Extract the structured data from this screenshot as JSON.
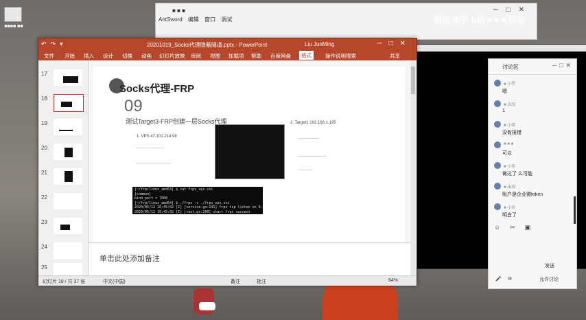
{
  "desktop": {
    "icon_label": "■■■■\n■■"
  },
  "antsword": {
    "title": "AntSword",
    "title_prefix": "■ ■ ■",
    "menu": [
      "AntSword",
      "编辑",
      "窗口",
      "调试"
    ]
  },
  "watermark": "微信 知乎 b站 ■ ■ ■ 同名",
  "powerpoint": {
    "qat": [
      "↶",
      "↷",
      "▾"
    ],
    "doc_title": "20201019_Socks代理隐蔽隧道.pptx - PowerPoint",
    "user": "Liu JunMing",
    "ribbon_tabs": [
      "文件",
      "开始",
      "插入",
      "设计",
      "切换",
      "动画",
      "幻灯片放映",
      "审阅",
      "视图",
      "加载项",
      "帮助",
      "百度网盘",
      "格式",
      "操作说明搜索",
      "共享"
    ],
    "thumb_numbers": [
      "17",
      "18",
      "19",
      "20",
      "21",
      "22",
      "23",
      "24",
      "25"
    ],
    "slide": {
      "title": "Socks代理-FRP",
      "number": "09",
      "subtitle": "测试Target3-FRP创建一层Socks代理",
      "ip_left": "1. VPS  47.101.214.98",
      "ip_right": "2. Target1  192.168.1.195",
      "terminal_lines": [
        "[~/frp/linux_amd64] $ cat frps_vps.ini",
        "[common]",
        "bind_port = 7000",
        "[~/frp/linux_amd64] $ ./frps -c ./frps_vps.ini",
        "2020/05/12 16:45:02 [I] [service.go:141] frps tcp listen on 0.0.0.0:7000",
        "2020/05/12 16:45:02 [I] [root.go:200] start frps success"
      ]
    },
    "notes_placeholder": "单击此处添加备注",
    "status": {
      "slide_count": "幻灯片 18 / 共 37 张",
      "language": "中文(中国)",
      "notes": "备注",
      "comments": "批注",
      "zoom": "64%"
    }
  },
  "chat": {
    "title": "讨论区",
    "messages": [
      {
        "name": "■ 小贾",
        "text": "嗯"
      },
      {
        "name": "■ 出现",
        "text": "1"
      },
      {
        "name": "■ 小蒋",
        "text": "没有报错"
      },
      {
        "name": "■ ■ ■",
        "text": "可以"
      },
      {
        "name": "■ 小吴",
        "text": "做过了  么可能"
      },
      {
        "name": "■ 出现",
        "text": "账户是企业微token"
      },
      {
        "name": "■ 小吴",
        "text": "明白了"
      }
    ],
    "send": "发送",
    "footer": "允许讨论"
  }
}
